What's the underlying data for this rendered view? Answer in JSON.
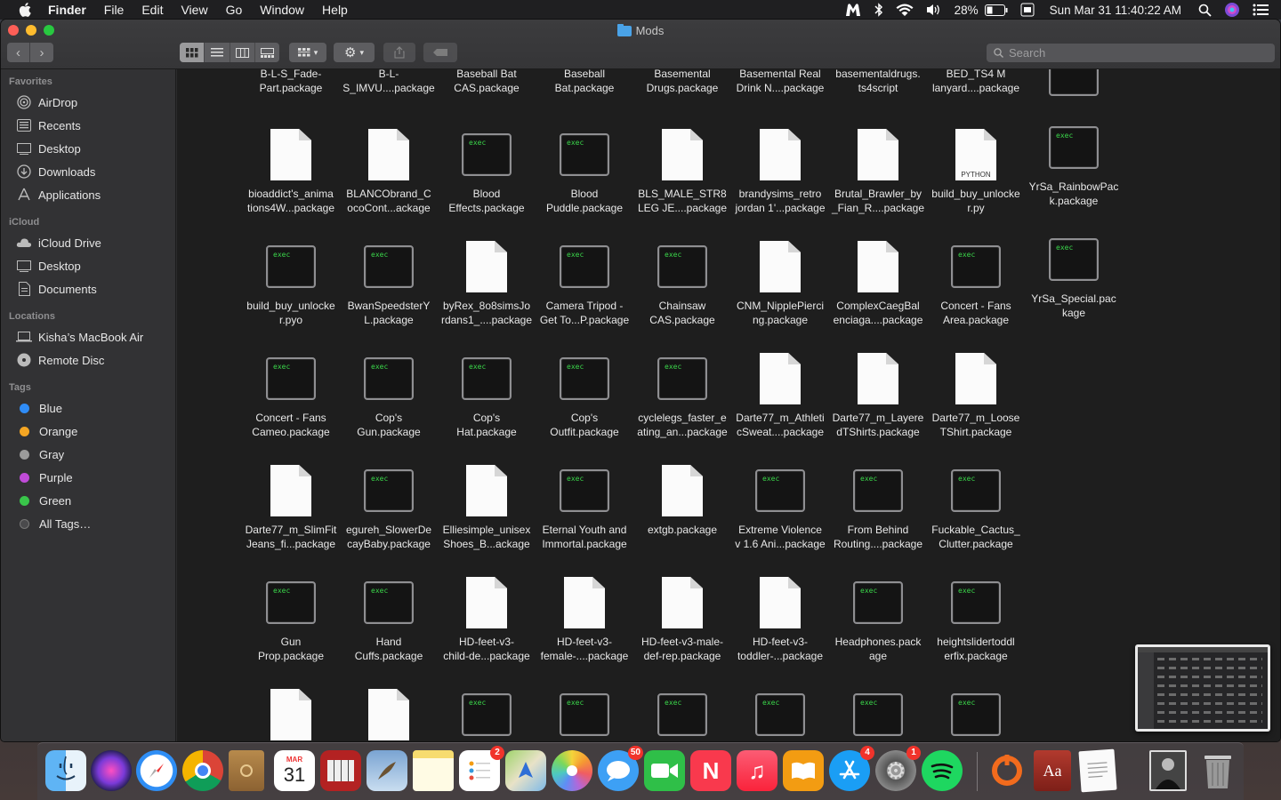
{
  "menubar": {
    "app_name": "Finder",
    "menus": [
      "File",
      "Edit",
      "View",
      "Go",
      "Window",
      "Help"
    ],
    "battery": "28%",
    "clock": "Sun Mar 31  11:40:22 AM"
  },
  "window": {
    "title": "Mods",
    "search_placeholder": "Search"
  },
  "sidebar": {
    "favorites_header": "Favorites",
    "favorites": [
      {
        "label": "AirDrop",
        "icon": "airdrop-icon"
      },
      {
        "label": "Recents",
        "icon": "recents-icon"
      },
      {
        "label": "Desktop",
        "icon": "desktop-icon"
      },
      {
        "label": "Downloads",
        "icon": "downloads-icon"
      },
      {
        "label": "Applications",
        "icon": "applications-icon"
      }
    ],
    "icloud_header": "iCloud",
    "icloud": [
      {
        "label": "iCloud Drive",
        "icon": "cloud-icon"
      },
      {
        "label": "Desktop",
        "icon": "desktop-icon"
      },
      {
        "label": "Documents",
        "icon": "document-icon"
      }
    ],
    "locations_header": "Locations",
    "locations": [
      {
        "label": "Kisha’s MacBook Air",
        "icon": "laptop-icon"
      },
      {
        "label": "Remote Disc",
        "icon": "disc-icon"
      }
    ],
    "tags_header": "Tags",
    "tags": [
      {
        "label": "Blue",
        "color": "#2f8cf6"
      },
      {
        "label": "Orange",
        "color": "#f5a623"
      },
      {
        "label": "Gray",
        "color": "#9b9b9b"
      },
      {
        "label": "Purple",
        "color": "#c04bd8"
      },
      {
        "label": "Green",
        "color": "#39c54a"
      },
      {
        "label": "All Tags…",
        "color": "#4a4a4c"
      }
    ]
  },
  "files": [
    {
      "name": "B-L-S_Fade-Part.package",
      "l1": "B-L-S_Fade-",
      "l2": "Part.package",
      "kind": "none"
    },
    {
      "name": "B-L-S_IMVU....package",
      "l1": "B-L-",
      "l2": "S_IMVU....package",
      "kind": "none"
    },
    {
      "name": "Baseball Bat CAS.package",
      "l1": "Baseball Bat",
      "l2": "CAS.package",
      "kind": "none"
    },
    {
      "name": "Baseball Bat.package",
      "l1": "Baseball",
      "l2": "Bat.package",
      "kind": "none"
    },
    {
      "name": "Basemental Drugs.package",
      "l1": "Basemental",
      "l2": "Drugs.package",
      "kind": "none"
    },
    {
      "name": "Basemental Real Drink N....package",
      "l1": "Basemental Real",
      "l2": "Drink N....package",
      "kind": "none"
    },
    {
      "name": "basementaldrugs.ts4script",
      "l1": "basementaldrugs.",
      "l2": "ts4script",
      "kind": "none"
    },
    {
      "name": "BED_TS4 M lanyard....package",
      "l1": "BED_TS4 M",
      "l2": "lanyard....package",
      "kind": "none"
    },
    {
      "name": "bioaddict's_animations4W...package",
      "l1": "bioaddict's_anima",
      "l2": "tions4W...package",
      "kind": "doc"
    },
    {
      "name": "BLANCObrand_CocoCont...ackage",
      "l1": "BLANCObrand_C",
      "l2": "ocoCont...ackage",
      "kind": "doc"
    },
    {
      "name": "Blood Effects.package",
      "l1": "Blood",
      "l2": "Effects.package",
      "kind": "exec"
    },
    {
      "name": "Blood Puddle.package",
      "l1": "Blood",
      "l2": "Puddle.package",
      "kind": "exec"
    },
    {
      "name": "BLS_MALE_STR8 LEG JE....package",
      "l1": "BLS_MALE_STR8",
      "l2": "LEG JE....package",
      "kind": "doc"
    },
    {
      "name": "brandysims_retro jordan 1'...package",
      "l1": "brandysims_retro",
      "l2": "jordan 1'...package",
      "kind": "doc"
    },
    {
      "name": "Brutal_Brawler_by_Fian_R....package",
      "l1": "Brutal_Brawler_by",
      "l2": "_Fian_R....package",
      "kind": "doc"
    },
    {
      "name": "build_buy_unlocker.py",
      "l1": "build_buy_unlocke",
      "l2": "r.py",
      "kind": "python"
    },
    {
      "name": "build_buy_unlocker.pyo",
      "l1": "build_buy_unlocke",
      "l2": "r.pyo",
      "kind": "exec"
    },
    {
      "name": "BwanSpeedsterYL.package",
      "l1": "BwanSpeedsterY",
      "l2": "L.package",
      "kind": "exec"
    },
    {
      "name": "byRex_8o8simsJordans1_....package",
      "l1": "byRex_8o8simsJo",
      "l2": "rdans1_....package",
      "kind": "doc"
    },
    {
      "name": "Camera Tripod - Get To...P.package",
      "l1": "Camera Tripod -",
      "l2": "Get To...P.package",
      "kind": "exec"
    },
    {
      "name": "Chainsaw CAS.package",
      "l1": "Chainsaw",
      "l2": "CAS.package",
      "kind": "exec"
    },
    {
      "name": "CNM_NipplePiercing.package",
      "l1": "CNM_NipplePierci",
      "l2": "ng.package",
      "kind": "doc"
    },
    {
      "name": "ComplexCaegBalenciaga....package",
      "l1": "ComplexCaegBal",
      "l2": "enciaga....package",
      "kind": "doc"
    },
    {
      "name": "Concert - Fans Area.package",
      "l1": "Concert - Fans",
      "l2": "Area.package",
      "kind": "exec"
    },
    {
      "name": "Concert - Fans Cameo.package",
      "l1": "Concert - Fans",
      "l2": "Cameo.package",
      "kind": "exec"
    },
    {
      "name": "Cop's Gun.package",
      "l1": "Cop's",
      "l2": "Gun.package",
      "kind": "exec"
    },
    {
      "name": "Cop's Hat.package",
      "l1": "Cop's",
      "l2": "Hat.package",
      "kind": "exec"
    },
    {
      "name": "Cop's Outfit.package",
      "l1": "Cop's",
      "l2": "Outfit.package",
      "kind": "exec"
    },
    {
      "name": "cyclelegs_faster_eating_an...package",
      "l1": "cyclelegs_faster_e",
      "l2": "ating_an...package",
      "kind": "exec"
    },
    {
      "name": "Darte77_m_AthleticSweat....package",
      "l1": "Darte77_m_Athleti",
      "l2": "cSweat....package",
      "kind": "doc"
    },
    {
      "name": "Darte77_m_LayeredTShirts.package",
      "l1": "Darte77_m_Layere",
      "l2": "dTShirts.package",
      "kind": "doc"
    },
    {
      "name": "Darte77_m_LooseTShirt.package",
      "l1": "Darte77_m_Loose",
      "l2": "TShirt.package",
      "kind": "doc"
    },
    {
      "name": "Darte77_m_SlimFitJeans_fi...package",
      "l1": "Darte77_m_SlimFit",
      "l2": "Jeans_fi...package",
      "kind": "doc"
    },
    {
      "name": "egureh_SlowerDecayBaby.package",
      "l1": "egureh_SlowerDe",
      "l2": "cayBaby.package",
      "kind": "exec"
    },
    {
      "name": "Elliesimple_unisexShoes_B...ackage",
      "l1": "Elliesimple_unisex",
      "l2": "Shoes_B...ackage",
      "kind": "doc"
    },
    {
      "name": "Eternal Youth and Immortal.package",
      "l1": "Eternal Youth and",
      "l2": "Immortal.package",
      "kind": "exec"
    },
    {
      "name": "extgb.package",
      "l1": "extgb.package",
      "l2": "",
      "kind": "doc"
    },
    {
      "name": "Extreme Violence v 1.6 Ani...package",
      "l1": "Extreme Violence",
      "l2": "v 1.6 Ani...package",
      "kind": "exec"
    },
    {
      "name": "From Behind Routing....package",
      "l1": "From Behind",
      "l2": "Routing....package",
      "kind": "exec"
    },
    {
      "name": "Fuckable_Cactus_Clutter.package",
      "l1": "Fuckable_Cactus_",
      "l2": "Clutter.package",
      "kind": "exec"
    },
    {
      "name": "Gun Prop.package",
      "l1": "Gun",
      "l2": "Prop.package",
      "kind": "exec"
    },
    {
      "name": "Hand Cuffs.package",
      "l1": "Hand",
      "l2": "Cuffs.package",
      "kind": "exec"
    },
    {
      "name": "HD-feet-v3-child-de...package",
      "l1": "HD-feet-v3-",
      "l2": "child-de...package",
      "kind": "doc"
    },
    {
      "name": "HD-feet-v3-female-....package",
      "l1": "HD-feet-v3-",
      "l2": "female-....package",
      "kind": "doc"
    },
    {
      "name": "HD-feet-v3-male-def-rep.package",
      "l1": "HD-feet-v3-male-",
      "l2": "def-rep.package",
      "kind": "doc"
    },
    {
      "name": "HD-feet-v3-toddler-...package",
      "l1": "HD-feet-v3-",
      "l2": "toddler-...package",
      "kind": "doc"
    },
    {
      "name": "Headphones.package",
      "l1": "Headphones.pack",
      "l2": "age",
      "kind": "exec"
    },
    {
      "name": "heightslidertoddlerfix.package",
      "l1": "heightslidertoddl",
      "l2": "erfix.package",
      "kind": "exec"
    },
    {
      "name": "",
      "l1": "",
      "l2": "",
      "kind": "doc"
    },
    {
      "name": "",
      "l1": "",
      "l2": "",
      "kind": "doc"
    },
    {
      "name": "",
      "l1": "",
      "l2": "",
      "kind": "exec"
    },
    {
      "name": "",
      "l1": "",
      "l2": "",
      "kind": "exec"
    },
    {
      "name": "",
      "l1": "",
      "l2": "",
      "kind": "exec"
    },
    {
      "name": "",
      "l1": "",
      "l2": "",
      "kind": "exec"
    },
    {
      "name": "",
      "l1": "",
      "l2": "",
      "kind": "exec"
    },
    {
      "name": "",
      "l1": "",
      "l2": "",
      "kind": "exec"
    }
  ],
  "extra_column": [
    {
      "name": "",
      "l1": "",
      "l2": "",
      "kind": "exec"
    },
    {
      "name": "YrSa_RainbowPack.package",
      "l1": "YrSa_RainbowPac",
      "l2": "k.package",
      "kind": "exec"
    },
    {
      "name": "YrSa_Special.package",
      "l1": "YrSa_Special.pac",
      "l2": "kage",
      "kind": "exec"
    }
  ],
  "icon_text": {
    "exec": "exec",
    "python": "PYTHON"
  },
  "dock": {
    "calendar_month": "MAR",
    "calendar_day": "31",
    "reminders_badge": "2",
    "messages_badge": "50",
    "appstore_badge": "4",
    "sysprefs_badge": "1",
    "dictionary_label": "Aa",
    "apps": [
      "Finder",
      "Siri",
      "Safari",
      "Chrome",
      "Contacts",
      "Calendar",
      "Photo Booth",
      "Preview",
      "Notes",
      "Reminders",
      "Maps",
      "Photos",
      "Messages",
      "FaceTime",
      "News",
      "Music",
      "Books",
      "App Store",
      "System Preferences",
      "Spotify",
      "Pitch",
      "Dictionary",
      "TextEdit",
      "Image",
      "Trash"
    ]
  }
}
